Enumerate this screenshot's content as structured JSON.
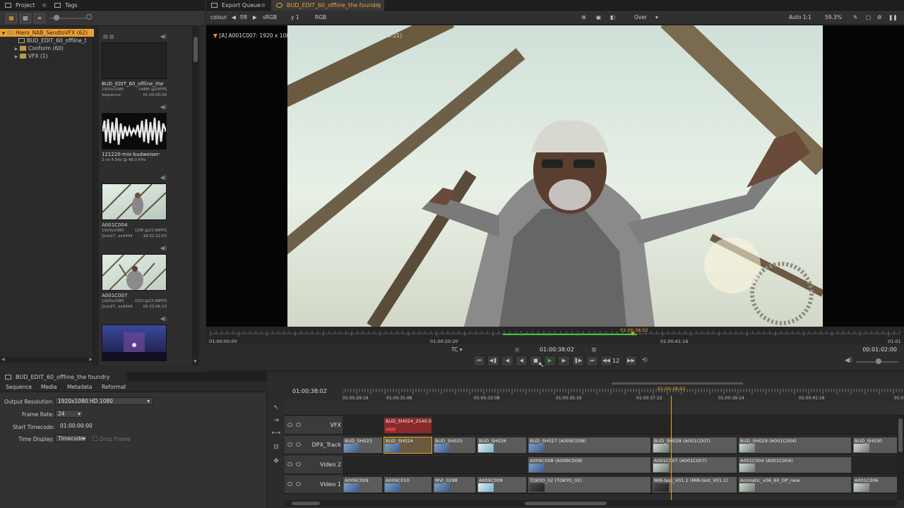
{
  "top_tabs_left": [
    {
      "label": "Project",
      "active": false
    },
    {
      "label": "Tags",
      "active": false
    }
  ],
  "top_tabs_right": [
    {
      "label": "Export Queue",
      "active": false
    },
    {
      "label": "BUD_EDIT_60_offline_the foundry",
      "active": true
    }
  ],
  "project": {
    "tree": [
      {
        "label": "Hiero_NAB_SendtoVFX (62)",
        "selected": true,
        "level": 0,
        "icon": "folder-icon"
      },
      {
        "label": "BUD_EDIT_60_offline_t",
        "selected": false,
        "level": 1,
        "icon": "sequence-icon"
      },
      {
        "label": "Conform (60)",
        "selected": false,
        "level": 1,
        "icon": "folder-icon"
      },
      {
        "label": "VFX (1)",
        "selected": false,
        "level": 1,
        "icon": "folder-icon"
      }
    ],
    "bin_items": [
      {
        "title": "BUD_EDIT_60_offline_the",
        "meta1_left": "1920x1080",
        "meta1_right": "1488f @24FPS",
        "meta2_left": "Sequence",
        "meta2_right": "01:00:00:00",
        "thumb": "sequence"
      },
      {
        "title": "121220-mix-budweiser-",
        "meta1_left": "2 ch 4 bits @ 48.0 KHz",
        "meta1_right": "",
        "meta2_left": "",
        "meta2_right": "",
        "thumb": "audio"
      },
      {
        "title": "A001C004",
        "meta1_left": "1920x1080",
        "meta1_right": "139f @23.98FPS",
        "meta2_left": "QuickT...es4444",
        "meta2_right": "18:32:22:03",
        "thumb": "image"
      },
      {
        "title": "A001C007",
        "meta1_left": "1920x1080",
        "meta1_right": "101f @23.98FPS",
        "meta2_left": "QuickT...es4444",
        "meta2_right": "00:33:56:23",
        "thumb": "image"
      },
      {
        "title": "",
        "meta1_left": "",
        "meta1_right": "",
        "meta2_left": "",
        "meta2_right": "",
        "thumb": "stage"
      }
    ]
  },
  "viewer_toolbar": {
    "colour": "colour",
    "fstop": "f/8",
    "lut": "sRGB",
    "gamma": "y 1",
    "channels": "RGB",
    "wipe": "Over",
    "zoom_mode": "Auto 1:1",
    "zoom_percent": "59.3%"
  },
  "viewer": {
    "info": "[A] A001C007: 1920 x 1080 – 23.98 FPS – 01:00:38:01 (00:33:58:21)"
  },
  "ruler": {
    "playhead_tc": "01:00:38:02",
    "ticks": [
      "01:00:00:00",
      "01:00:20:20",
      "01:00:41:16",
      "01:01"
    ]
  },
  "transport": {
    "tc_label": "TC",
    "in_marker": "I",
    "current_tc": "01:00:38:02",
    "out_marker": "O",
    "duration": "00:01:02:00",
    "step_frames": "12"
  },
  "properties": {
    "title": "BUD_EDIT_60_offline_the foundry",
    "tabs": [
      "Sequence",
      "Media",
      "Metadata",
      "Reformat"
    ],
    "output_resolution_label": "Output Resolution:",
    "output_resolution": "1920x1080 HD 1080",
    "frame_rate_label": "Frame Rate:",
    "frame_rate": "24",
    "start_timecode_label": "Start Timecode:",
    "start_timecode": "01:00:00:00",
    "time_display_label": "Time Display:",
    "time_display": "Timecode",
    "drop_frame": "Drop Frame"
  },
  "timeline": {
    "current_tc": "01:00:38:02",
    "playhead_tc": "01:00:38:02",
    "ruler_ticks": [
      "01:00:29:16",
      "01:00:31:06",
      "01:00:33:08",
      "01:00:35:10",
      "01:00:37:12",
      "01:00:39:14",
      "01:00:41:16",
      "01:0"
    ],
    "tracks": [
      {
        "name": "VFX",
        "clips": [
          {
            "label": "BUD_SH024_2540.0%",
            "start": 58,
            "width": 70,
            "style": "red",
            "thumb": "none"
          }
        ]
      },
      {
        "name": "DPX_Track",
        "clips": [
          {
            "label": "BUD_SH023",
            "start": 0,
            "width": 58,
            "style": "normal",
            "thumb": "blue"
          },
          {
            "label": "BUD_SH024",
            "start": 58,
            "width": 70,
            "style": "sel",
            "thumb": "blue"
          },
          {
            "label": "BUD_SH025",
            "start": 128,
            "width": 62,
            "style": "normal",
            "thumb": "blue"
          },
          {
            "label": "BUD_SH026",
            "start": 190,
            "width": 72,
            "style": "normal",
            "thumb": "light"
          },
          {
            "label": "BUD_SH027 (A009C008)",
            "start": 262,
            "width": 176,
            "style": "normal",
            "thumb": "blue"
          },
          {
            "label": "BUD_SH028 (A001C007)",
            "start": 438,
            "width": 122,
            "style": "normal",
            "thumb": "gray"
          },
          {
            "label": "BUD_SH029 (A001C004)",
            "start": 560,
            "width": 162,
            "style": "normal",
            "thumb": "gray"
          },
          {
            "label": "BUD_SH030",
            "start": 722,
            "width": 73,
            "style": "normal",
            "thumb": "gray"
          }
        ]
      },
      {
        "name": "Video 2",
        "clips": [
          {
            "label": "A009C008 (A009C008)",
            "start": 262,
            "width": 176,
            "style": "normal",
            "thumb": "blue"
          },
          {
            "label": "A001C007 (A001C007)",
            "start": 438,
            "width": 122,
            "style": "normal",
            "thumb": "gray"
          },
          {
            "label": "A001C004 (A001C004)",
            "start": 560,
            "width": 162,
            "style": "normal",
            "thumb": "gray"
          }
        ]
      },
      {
        "name": "Video 1",
        "clips": [
          {
            "label": "A009C009",
            "start": 0,
            "width": 58,
            "style": "normal",
            "thumb": "blue"
          },
          {
            "label": "A009C010",
            "start": 58,
            "width": 70,
            "style": "normal",
            "thumb": "blue"
          },
          {
            "label": "MVI_0298",
            "start": 128,
            "width": 62,
            "style": "normal",
            "thumb": "blue"
          },
          {
            "label": "A009C009",
            "start": 190,
            "width": 72,
            "style": "normal",
            "thumb": "light"
          },
          {
            "label": "TOKYO_02 (TOKYO_02)",
            "start": 262,
            "width": 176,
            "style": "normal",
            "thumb": "dark"
          },
          {
            "label": "MIR-test_V01.1 (MIR-test_V01.1)",
            "start": 438,
            "width": 122,
            "style": "normal",
            "thumb": "dark"
          },
          {
            "label": "Animatic_v06_60_OP_new",
            "start": 560,
            "width": 162,
            "style": "normal",
            "thumb": "gray"
          },
          {
            "label": "A001C006",
            "start": 722,
            "width": 73,
            "style": "normal",
            "thumb": "gray"
          }
        ]
      }
    ]
  },
  "colors": {
    "accent": "#f0a030",
    "play": "#3cc83c",
    "background": "#2b2b2b"
  }
}
